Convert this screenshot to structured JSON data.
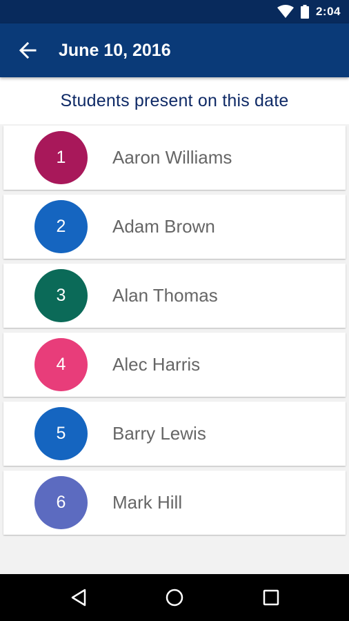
{
  "status_bar": {
    "time": "2:04",
    "icons": [
      "wifi-icon",
      "battery-icon"
    ]
  },
  "app_bar": {
    "title": "June 10, 2016",
    "back_icon": "arrow-back-icon"
  },
  "subtitle": "Students present on this date",
  "students": [
    {
      "number": "1",
      "name": "Aaron Williams",
      "color": "#a8185a"
    },
    {
      "number": "2",
      "name": "Adam Brown",
      "color": "#1565c0"
    },
    {
      "number": "3",
      "name": "Alan Thomas",
      "color": "#0b6a58"
    },
    {
      "number": "4",
      "name": "Alec Harris",
      "color": "#e83d7a"
    },
    {
      "number": "5",
      "name": "Barry Lewis",
      "color": "#1565c0"
    },
    {
      "number": "6",
      "name": "Mark Hill",
      "color": "#5c6bc0"
    }
  ],
  "nav_bar": {
    "icons": [
      "back-triangle-icon",
      "home-circle-icon",
      "recents-square-icon"
    ]
  },
  "colors": {
    "status_bar": "#082a5c",
    "app_bar": "#0a3a78",
    "subtitle_text": "#0f2a66",
    "name_text": "#666666",
    "background": "#f2f2f2"
  }
}
